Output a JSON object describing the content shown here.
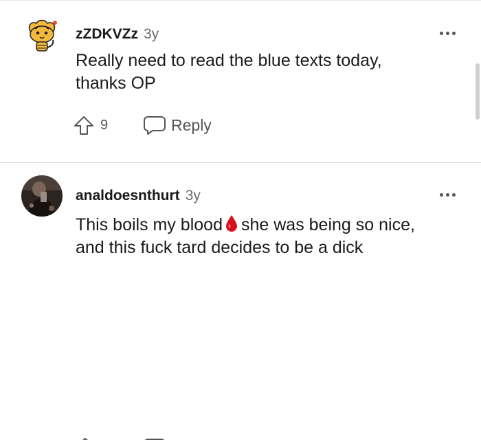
{
  "comments": [
    {
      "username": "zZDKVZz",
      "age": "3y",
      "text_lines": [
        "Really need to read the blue texts today,",
        "thanks OP"
      ],
      "upvotes": "9",
      "reply_label": "Reply",
      "avatar_icon": "snoo-tiger-avatar-icon"
    },
    {
      "username": "analdoesnthurt",
      "age": "3y",
      "text_line1_before": "This boils my blood",
      "emoji_icon": "blood-drop-icon",
      "text_line1_after": "she was being so nice,",
      "text_line2": "and this fuck tard decides to be a dick",
      "avatar_icon": "user-photo-avatar"
    }
  ],
  "colors": {
    "username": "#1a1a1b",
    "meta": "#6b6b6b",
    "icons": "#555555",
    "divider": "#dcdcdc",
    "blood_drop": "#d4111c"
  }
}
